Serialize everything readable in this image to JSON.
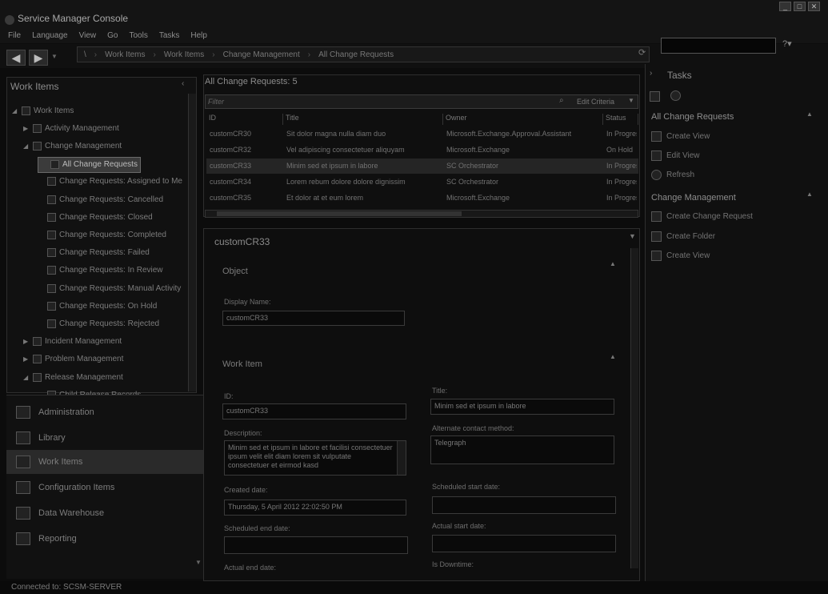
{
  "window": {
    "title": "Service Manager Console",
    "buttons": [
      "_",
      "□",
      "✕"
    ]
  },
  "menu": [
    "File",
    "Language",
    "View",
    "Go",
    "Tools",
    "Tasks",
    "Help"
  ],
  "breadcrumb": [
    "\\",
    "Work Items",
    "Work Items",
    "Change Management",
    "All Change Requests"
  ],
  "left_panel": {
    "title": "Work Items",
    "tree": [
      {
        "label": "Work Items",
        "level": 0,
        "arrow": "◢"
      },
      {
        "label": "Activity Management",
        "level": 1,
        "arrow": "▶"
      },
      {
        "label": "Change Management",
        "level": 1,
        "arrow": "◢"
      },
      {
        "label": "All Change Requests",
        "level": 2,
        "arrow": "",
        "selected": true
      },
      {
        "label": "Change Requests: Assigned to Me",
        "level": 2,
        "arrow": ""
      },
      {
        "label": "Change Requests: Cancelled",
        "level": 2,
        "arrow": ""
      },
      {
        "label": "Change Requests: Closed",
        "level": 2,
        "arrow": ""
      },
      {
        "label": "Change Requests: Completed",
        "level": 2,
        "arrow": ""
      },
      {
        "label": "Change Requests: Failed",
        "level": 2,
        "arrow": ""
      },
      {
        "label": "Change Requests: In Review",
        "level": 2,
        "arrow": ""
      },
      {
        "label": "Change Requests: Manual Activity",
        "level": 2,
        "arrow": ""
      },
      {
        "label": "Change Requests: On Hold",
        "level": 2,
        "arrow": ""
      },
      {
        "label": "Change Requests: Rejected",
        "level": 2,
        "arrow": ""
      },
      {
        "label": "Incident Management",
        "level": 1,
        "arrow": "▶"
      },
      {
        "label": "Problem Management",
        "level": 1,
        "arrow": "▶"
      },
      {
        "label": "Release Management",
        "level": 1,
        "arrow": "◢"
      },
      {
        "label": "Child Release Records",
        "level": 2,
        "arrow": ""
      }
    ]
  },
  "nav": [
    {
      "label": "Administration"
    },
    {
      "label": "Library"
    },
    {
      "label": "Work Items",
      "active": true
    },
    {
      "label": "Configuration Items"
    },
    {
      "label": "Data Warehouse"
    },
    {
      "label": "Reporting"
    }
  ],
  "status": "Connected to: SCSM-SERVER",
  "list": {
    "title": "All Change Requests: 5",
    "filter_placeholder": "Filter",
    "edit_criteria": "Edit Criteria",
    "columns": [
      "ID",
      "Title",
      "Owner",
      "Status"
    ],
    "rows": [
      {
        "id": "customCR30",
        "title": "Sit dolor magna nulla diam duo",
        "owner": "Microsoft.Exchange.Approval.Assistant",
        "status": "In Progress"
      },
      {
        "id": "customCR32",
        "title": "Vel adipiscing consectetuer aliquyam",
        "owner": "Microsoft.Exchange",
        "status": "On Hold"
      },
      {
        "id": "customCR33",
        "title": "Minim sed et ipsum in labore",
        "owner": "SC Orchestrator",
        "status": "In Progress",
        "selected": true
      },
      {
        "id": "customCR34",
        "title": "Lorem rebum dolore dolore dignissim",
        "owner": "SC Orchestrator",
        "status": "In Progress"
      },
      {
        "id": "customCR35",
        "title": "Et dolor at et eum lorem",
        "owner": "Microsoft.Exchange",
        "status": "In Progress"
      }
    ]
  },
  "details": {
    "title": "customCR33",
    "object_section": "Object",
    "display_name_label": "Display Name:",
    "display_name_value": "customCR33",
    "work_item_section": "Work Item",
    "id_label": "ID:",
    "id_value": "customCR33",
    "title_label": "Title:",
    "title_value": "Minim sed et ipsum in labore",
    "description_label": "Description:",
    "description_value": "Minim sed et ipsum in labore et facilisi consectetuer ipsum velit elit diam lorem sit vulputate consectetuer et eirmod kasd",
    "alt_contact_label": "Alternate contact method:",
    "alt_contact_value": "Telegraph",
    "created_label": "Created date:",
    "created_value": "Thursday, 5 April 2012 22:02:50 PM",
    "sched_start_label": "Scheduled start date:",
    "sched_end_label": "Scheduled end date:",
    "actual_start_label": "Actual start date:",
    "actual_end_label": "Actual end date:",
    "downtime_label": "Is Downtime:"
  },
  "tasks": {
    "title": "Tasks",
    "group1": "All Change Requests",
    "group1_items": [
      "Create View",
      "Edit View",
      "Refresh"
    ],
    "group2": "Change Management",
    "group2_items": [
      "Create Change Request",
      "Create Folder",
      "Create View"
    ]
  }
}
